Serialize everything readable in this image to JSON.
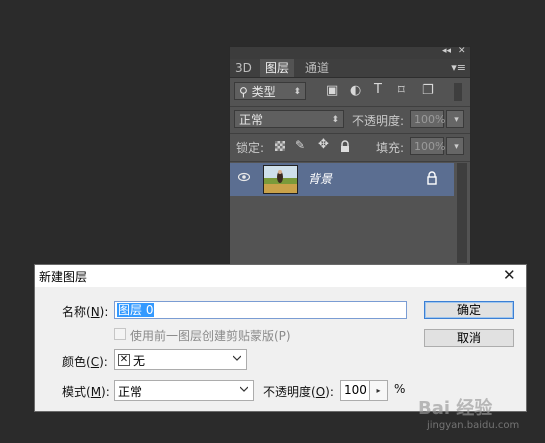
{
  "layers_panel": {
    "tabs": [
      "3D",
      "图层",
      "通道"
    ],
    "active_tab": "图层",
    "filter": {
      "kind": "类型"
    },
    "blend_mode": "正常",
    "opacity_label": "不透明度:",
    "opacity_value": "100%",
    "lock_label": "锁定:",
    "fill_label": "填充:",
    "fill_value": "100%",
    "layer": {
      "name": "背景"
    }
  },
  "dialog": {
    "title": "新建图层",
    "name_label_pre": "名称(",
    "name_label_key": "N",
    "name_label_post": "):",
    "name_value": "图层 0",
    "clip_label": "使用前一图层创建剪贴蒙版(P)",
    "color_label_pre": "颜色(",
    "color_label_key": "C",
    "color_label_post": "):",
    "color_value": "无",
    "mode_label_pre": "模式(",
    "mode_label_key": "M",
    "mode_label_post": "):",
    "mode_value": "正常",
    "opacity_label_pre": "不透明度(",
    "opacity_label_key": "O",
    "opacity_label_post": "):",
    "opacity_value": "100",
    "percent": "%",
    "ok_label": "确定",
    "cancel_label": "取消"
  },
  "watermark": {
    "text": "Bai 经验",
    "url": "jingyan.baidu.com"
  }
}
